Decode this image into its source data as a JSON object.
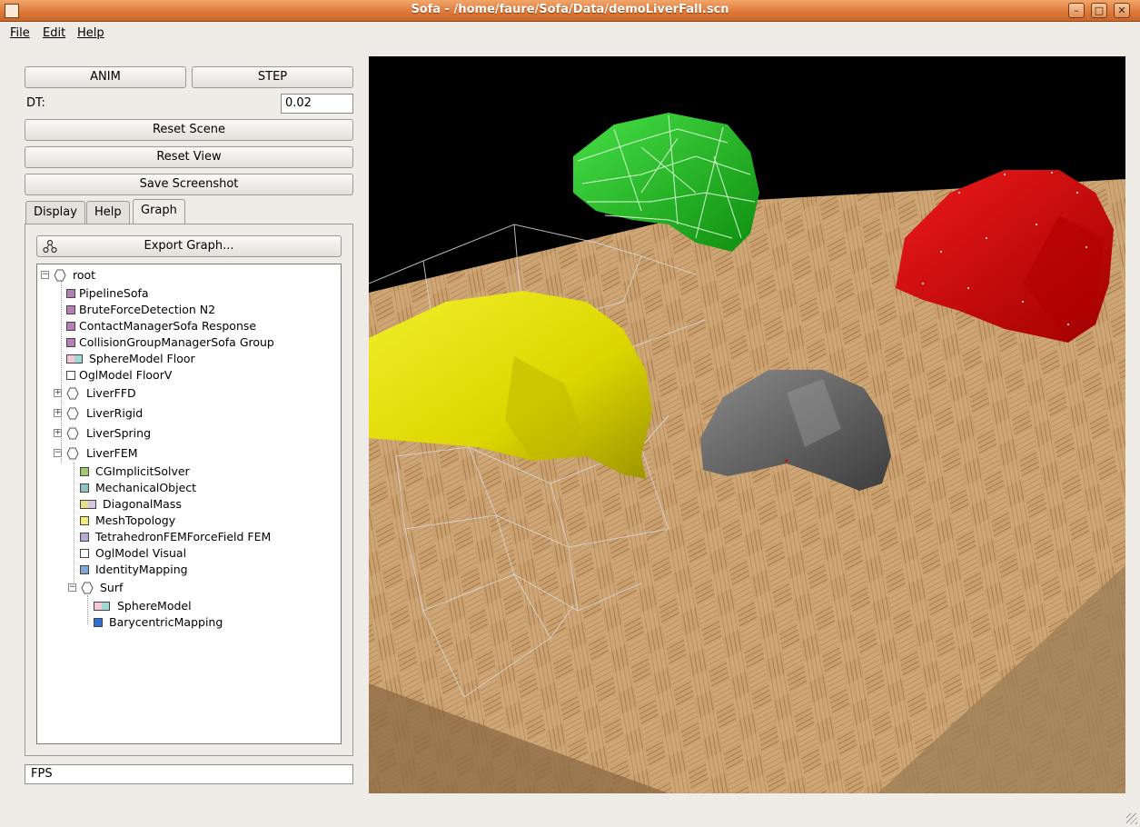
{
  "window": {
    "title": "Sofa - /home/faure/Sofa/Data/demoLiverFall.scn",
    "minimize_glyph": "–",
    "maximize_glyph": "□",
    "close_glyph": "✕"
  },
  "menubar": {
    "file": "File",
    "edit": "Edit",
    "help": "Help"
  },
  "controls": {
    "anim_label": "ANIM",
    "step_label": "STEP",
    "dt_label": "DT:",
    "dt_value": "0.02",
    "reset_scene_label": "Reset Scene",
    "reset_view_label": "Reset View",
    "save_screenshot_label": "Save Screenshot"
  },
  "tabs": [
    {
      "label": "Display",
      "active": false
    },
    {
      "label": "Help",
      "active": false
    },
    {
      "label": "Graph",
      "active": true
    }
  ],
  "graph": {
    "export_label": "Export Graph...",
    "tree": [
      {
        "label": "root",
        "kind": "node",
        "expanded": true
      },
      {
        "label": "PipelineSofa",
        "kind": "component",
        "color": "#b77fb8"
      },
      {
        "label": "BruteForceDetection  N2",
        "kind": "component",
        "color": "#b77fb8"
      },
      {
        "label": "ContactManagerSofa  Response",
        "kind": "component",
        "color": "#b77fb8"
      },
      {
        "label": "CollisionGroupManagerSofa  Group",
        "kind": "component",
        "color": "#b77fb8"
      },
      {
        "label": "SphereModel  Floor",
        "kind": "component",
        "color": "#f4c8d6"
      },
      {
        "label": "OglModel  FloorV",
        "kind": "component",
        "color": "#ffffff"
      },
      {
        "label": "LiverFFD",
        "kind": "node",
        "expanded": false
      },
      {
        "label": "LiverRigid",
        "kind": "node",
        "expanded": false
      },
      {
        "label": "LiverSpring",
        "kind": "node",
        "expanded": false
      },
      {
        "label": "LiverFEM",
        "kind": "node",
        "expanded": true
      },
      {
        "label": "CGImplicitSolver",
        "kind": "component",
        "color": "#9fc96a"
      },
      {
        "label": "MechanicalObject",
        "kind": "component",
        "color": "#8fc3c2"
      },
      {
        "label": "DiagonalMass",
        "kind": "component",
        "color": "#e8e08a"
      },
      {
        "label": "MeshTopology",
        "kind": "component",
        "color": "#f2ec7a"
      },
      {
        "label": "TetrahedronFEMForceField  FEM",
        "kind": "component",
        "color": "#b9a7d8"
      },
      {
        "label": "OglModel  Visual",
        "kind": "component",
        "color": "#ffffff"
      },
      {
        "label": "IdentityMapping",
        "kind": "component",
        "color": "#7da9d8"
      },
      {
        "label": "Surf",
        "kind": "node",
        "expanded": true
      },
      {
        "label": "SphereModel",
        "kind": "component",
        "color": "#f4c8d6"
      },
      {
        "label": "BarycentricMapping",
        "kind": "component",
        "color": "#2d6fd6"
      }
    ]
  },
  "status": {
    "fps_label": "FPS"
  },
  "colors": {
    "titlebar": "#de7a3a",
    "liver_yellow": "#e6e000",
    "liver_green": "#1fb51f",
    "liver_red": "#d40000",
    "liver_gray": "#6b6b6b",
    "floor_wood": "#c49a6c"
  }
}
